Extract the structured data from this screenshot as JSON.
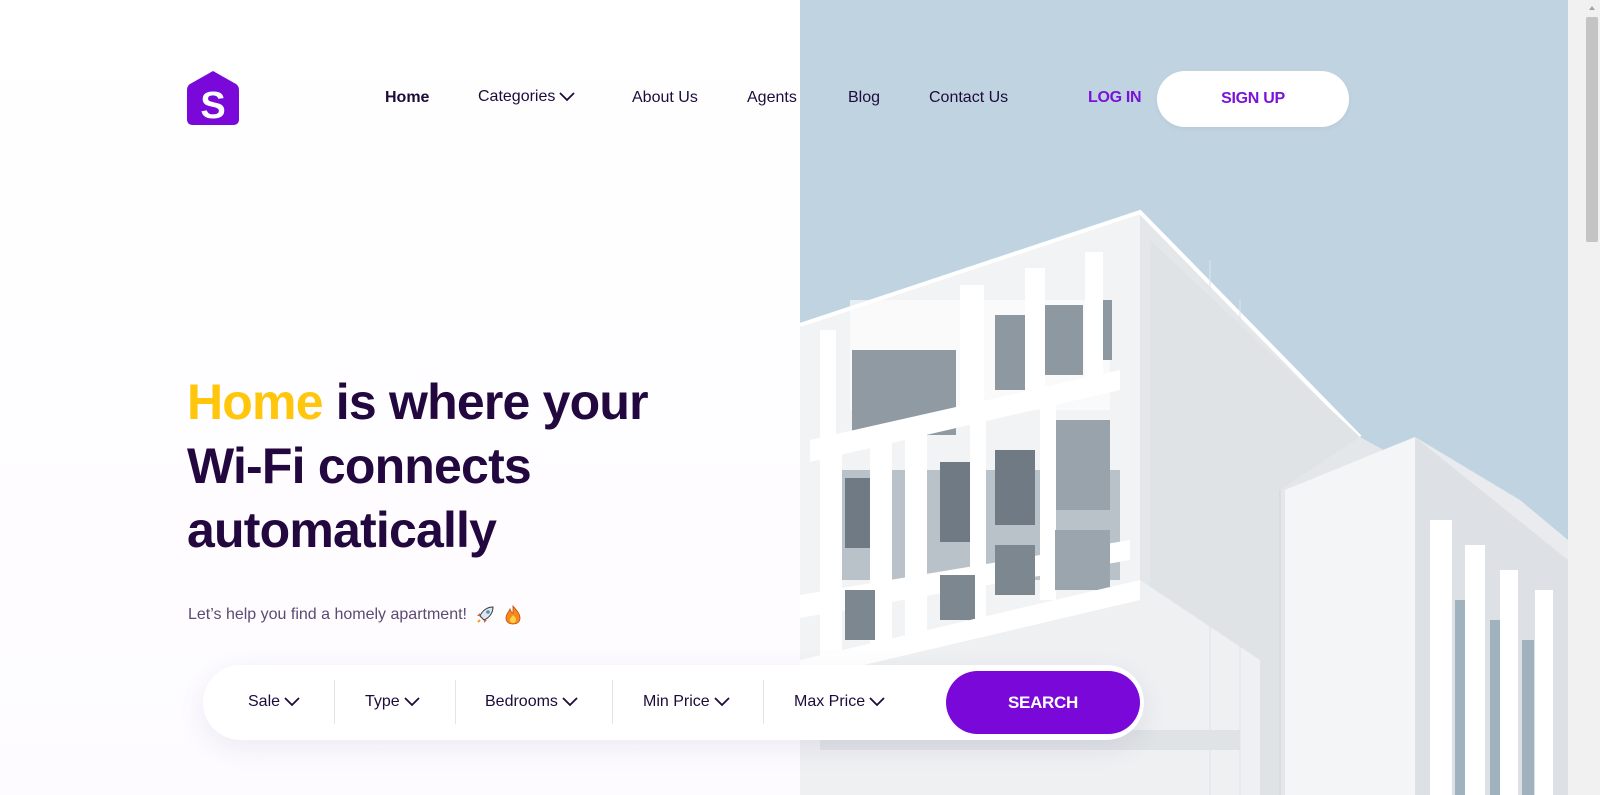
{
  "brand": {
    "logo_letter": "S",
    "accent": "#7a08d9",
    "highlight": "#ffc60b",
    "text_dark": "#22083f"
  },
  "nav": {
    "items": [
      {
        "label": "Home",
        "active": true
      },
      {
        "label": "Categories",
        "has_dropdown": true
      },
      {
        "label": "About Us"
      },
      {
        "label": "Agents"
      },
      {
        "label": "Blog"
      },
      {
        "label": "Contact Us"
      }
    ],
    "login_label": "LOG IN",
    "signup_label": "SIGN UP"
  },
  "hero": {
    "headline_highlight": "Home",
    "headline_rest_line1": " is where your",
    "headline_line2": "Wi-Fi connects",
    "headline_line3": "automatically",
    "subline": "Let’s help you find a homely apartment!",
    "subline_icons": [
      "rocket-icon",
      "fire-icon"
    ]
  },
  "search": {
    "filters": [
      {
        "label": "Sale"
      },
      {
        "label": "Type"
      },
      {
        "label": "Bedrooms"
      },
      {
        "label": "Min Price"
      },
      {
        "label": "Max Price"
      }
    ],
    "button_label": "SEARCH"
  }
}
